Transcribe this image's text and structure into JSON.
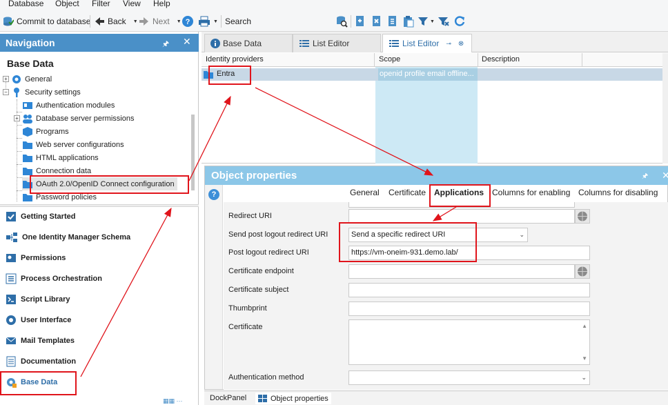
{
  "menu": [
    "Database",
    "Object",
    "Filter",
    "View",
    "Help"
  ],
  "toolbar": {
    "commit_label": "Commit to database",
    "back_label": "Back",
    "next_label": "Next",
    "search_label": "Search"
  },
  "nav": {
    "header": "Navigation",
    "title": "Base Data",
    "tree": [
      {
        "label": "General",
        "icon": "gear-icon"
      },
      {
        "label": "Security settings",
        "icon": "key-icon"
      },
      {
        "label": "Authentication modules",
        "icon": "id-card-icon"
      },
      {
        "label": "Database server permissions",
        "icon": "users-icon"
      },
      {
        "label": "Programs",
        "icon": "box-icon"
      },
      {
        "label": "Web server configurations",
        "icon": "folder-icon"
      },
      {
        "label": "HTML applications",
        "icon": "folder-icon"
      },
      {
        "label": "Connection data",
        "icon": "folder-icon"
      },
      {
        "label": "OAuth 2.0/OpenID Connect configuration",
        "icon": "folder-icon"
      },
      {
        "label": "Password policies",
        "icon": "folder-icon"
      }
    ],
    "categories": [
      {
        "label": "Getting Started",
        "icon": "checklist-icon"
      },
      {
        "label": "One Identity Manager Schema",
        "icon": "schema-icon"
      },
      {
        "label": "Permissions",
        "icon": "permissions-icon"
      },
      {
        "label": "Process Orchestration",
        "icon": "process-icon"
      },
      {
        "label": "Script Library",
        "icon": "script-icon"
      },
      {
        "label": "User Interface",
        "icon": "ui-icon"
      },
      {
        "label": "Mail Templates",
        "icon": "mail-icon"
      },
      {
        "label": "Documentation",
        "icon": "document-icon"
      },
      {
        "label": "Base Data",
        "icon": "base-data-icon"
      }
    ]
  },
  "tabs": [
    {
      "label": "Base Data",
      "icon": "info-icon"
    },
    {
      "label": "List Editor",
      "icon": "list-icon"
    },
    {
      "label": "List Editor",
      "icon": "list-icon",
      "active": true
    }
  ],
  "grid": {
    "columns": [
      "Identity providers",
      "Scope",
      "Description"
    ],
    "rows": [
      {
        "identity_provider": "Entra",
        "scope": "openid profile email offline...",
        "description": ""
      }
    ]
  },
  "object_properties": {
    "title": "Object properties",
    "tabs": [
      "General",
      "Certificate",
      "Applications",
      "Columns for enabling",
      "Columns for disabling"
    ],
    "active_tab": "Applications",
    "fields": {
      "redirect_uri": {
        "label": "Redirect URI",
        "value": ""
      },
      "send_post_logout": {
        "label": "Send post logout redirect URI",
        "value": "Send a specific redirect URI"
      },
      "post_logout_uri": {
        "label": "Post logout redirect URI",
        "value": "https://vm-oneim-931.demo.lab/"
      },
      "cert_endpoint": {
        "label": "Certificate endpoint",
        "value": ""
      },
      "cert_subject": {
        "label": "Certificate subject",
        "value": ""
      },
      "thumbprint": {
        "label": "Thumbprint",
        "value": ""
      },
      "certificate": {
        "label": "Certificate",
        "value": ""
      },
      "auth_method": {
        "label": "Authentication method",
        "value": ""
      }
    }
  },
  "bottom_tabs": [
    "DockPanel",
    "Object properties"
  ],
  "colors": {
    "nav_header": "#4a90c8",
    "op_header": "#8cc7e8",
    "annotation": "#e0141b",
    "selected_row": "#c8d8e6"
  }
}
